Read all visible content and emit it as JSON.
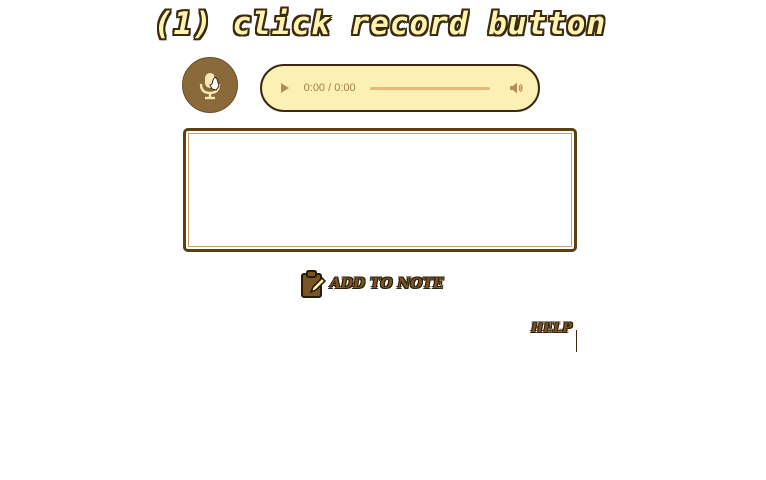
{
  "title": "(1) click record button",
  "record_button": {
    "icon": "microphone-icon",
    "color": "#8a6a3a"
  },
  "audio_player": {
    "time": "0:00 / 0:00",
    "play_icon": "play-icon",
    "volume_icon": "volume-icon",
    "background": "#fdf0b4"
  },
  "transcript": {
    "value": ""
  },
  "add_note": {
    "icon": "clipboard-edit-icon",
    "label": "ADD TO NOTE"
  },
  "help": {
    "label": "HELP"
  }
}
